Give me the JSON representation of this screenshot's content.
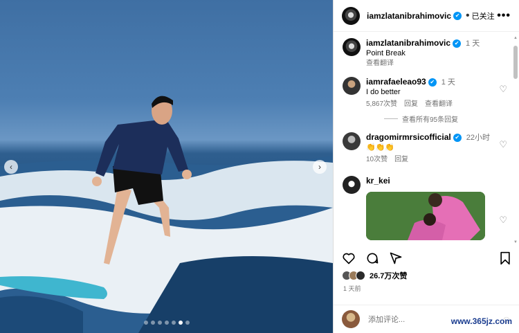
{
  "post": {
    "author": "iamzlatanibrahimovic",
    "follow_state": "已关注",
    "more": "•••"
  },
  "caption": {
    "username": "iamzlatanibrahimovic",
    "time": "1 天",
    "text": "Point Break",
    "translate": "查看翻译"
  },
  "comments": [
    {
      "username": "iamrafaeleao93",
      "time": "1 天",
      "text": "I do better",
      "likes": "5,867次赞",
      "reply": "回复",
      "translate": "查看翻译"
    },
    {
      "username": "dragomirmrsicofficial",
      "time": "22小时",
      "text": "👏👏👏",
      "likes": "10次赞",
      "reply": "回复"
    },
    {
      "username": "kr_kei"
    }
  ],
  "view_replies": "查看所有95条回复",
  "likes_total": "26.7万次赞",
  "posted_ago": "1 天前",
  "add_comment_placeholder": "添加评论...",
  "watermark": "www.365jz.com",
  "icons": {
    "verified": "✔",
    "heart": "♡",
    "emoji": "☺",
    "prev": "‹",
    "next": "›"
  },
  "carousel": {
    "slides": 7,
    "active_index": 5
  }
}
